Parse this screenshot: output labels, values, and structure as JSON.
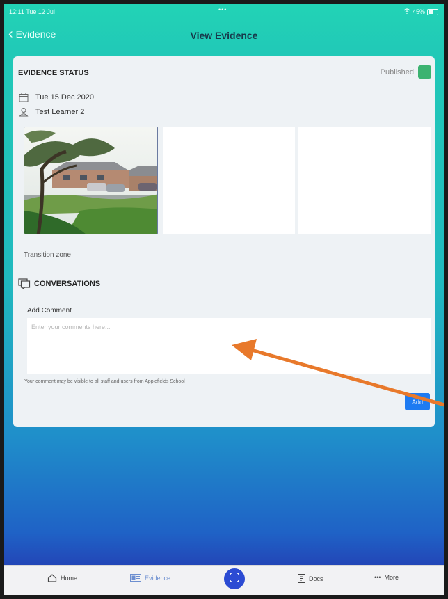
{
  "statusbar": {
    "time": "12:11  Tue 12 Jul",
    "dots": "•••",
    "battery": "45%"
  },
  "nav": {
    "back_label": "Evidence",
    "title": "View Evidence"
  },
  "evidence": {
    "status_heading": "EVIDENCE STATUS",
    "status_label": "Published",
    "status_color": "#3cb371",
    "date": "Tue 15 Dec 2020",
    "learner": "Test Learner 2",
    "caption": "Transition zone"
  },
  "conversations": {
    "heading": "CONVERSATIONS",
    "add_comment_label": "Add Comment",
    "comment_value": "",
    "comment_placeholder": "Enter your comments here...",
    "disclaimer": "Your comment may be visible to all staff and users from Applefields School",
    "add_button": "Add"
  },
  "tabs": [
    {
      "label": "Home",
      "icon": "home-icon"
    },
    {
      "label": "Evidence",
      "icon": "evidence-icon"
    },
    {
      "label": "",
      "icon": "capture-icon"
    },
    {
      "label": "Docs",
      "icon": "docs-icon"
    },
    {
      "label": "More",
      "icon": "more-icon"
    }
  ],
  "colors": {
    "accent": "#1d7bf2",
    "header_teal": "#22d3b6",
    "fab": "#2c4bd3",
    "annotation_arrow": "#e8792b"
  }
}
